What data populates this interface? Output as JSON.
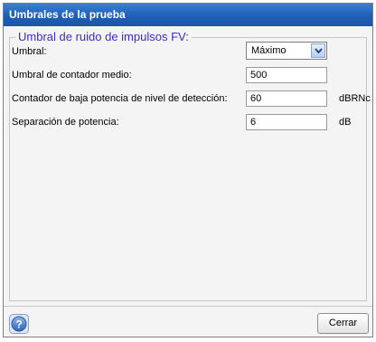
{
  "dialog": {
    "title": "Umbrales de la prueba",
    "group_title": "Umbral de ruido de impulsos FV:",
    "rows": [
      {
        "label": "Umbral:",
        "value": "Máximo",
        "unit": ""
      },
      {
        "label": "Umbral de contador medio:",
        "value": "500",
        "unit": ""
      },
      {
        "label": "Contador de baja potencia de nivel de detección:",
        "value": "60",
        "unit": "dBRNc"
      },
      {
        "label": "Separación de potencia:",
        "value": "6",
        "unit": "dB"
      }
    ],
    "close_label": "Cerrar",
    "help_icon": "question-mark-icon"
  },
  "colors": {
    "title_bar": "#1f5fb8",
    "group_title": "#3b2ccf",
    "help_button": "#3d78c9"
  }
}
